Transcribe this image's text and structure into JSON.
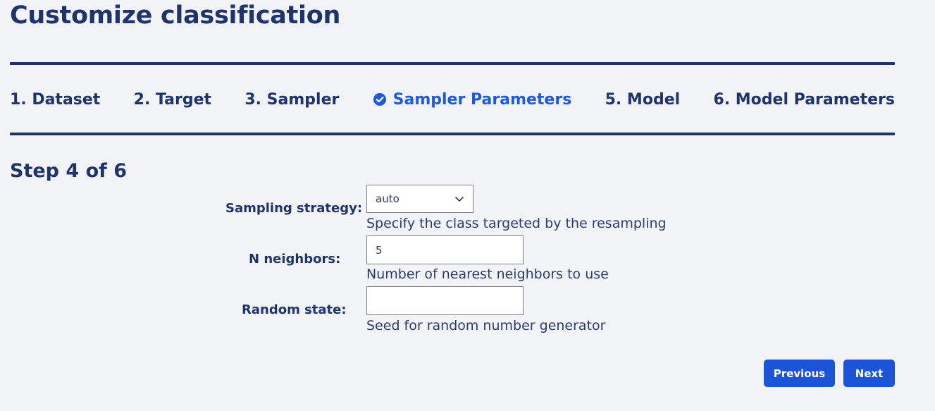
{
  "page": {
    "title": "Customize classification",
    "step_heading": "Step 4 of 6"
  },
  "stepper": {
    "steps": [
      {
        "label": "1. Dataset"
      },
      {
        "label": "2. Target"
      },
      {
        "label": "3. Sampler"
      },
      {
        "label": "Sampler Parameters",
        "icon": "check-circle-icon",
        "active": true
      },
      {
        "label": "5. Model"
      },
      {
        "label": "6. Model Parameters"
      }
    ]
  },
  "form": {
    "sampling_strategy": {
      "label": "Sampling strategy:",
      "value": "auto",
      "help": "Specify the class targeted by the resampling"
    },
    "n_neighbors": {
      "label": "N neighbors:",
      "value": "5",
      "help": "Number of nearest neighbors to use"
    },
    "random_state": {
      "label": "Random state:",
      "value": "",
      "help": "Seed for random number generator"
    }
  },
  "buttons": {
    "previous": "Previous",
    "next": "Next"
  },
  "colors": {
    "primary": "#1f3468",
    "accent": "#1c54d8",
    "background": "#f2f3f6"
  }
}
